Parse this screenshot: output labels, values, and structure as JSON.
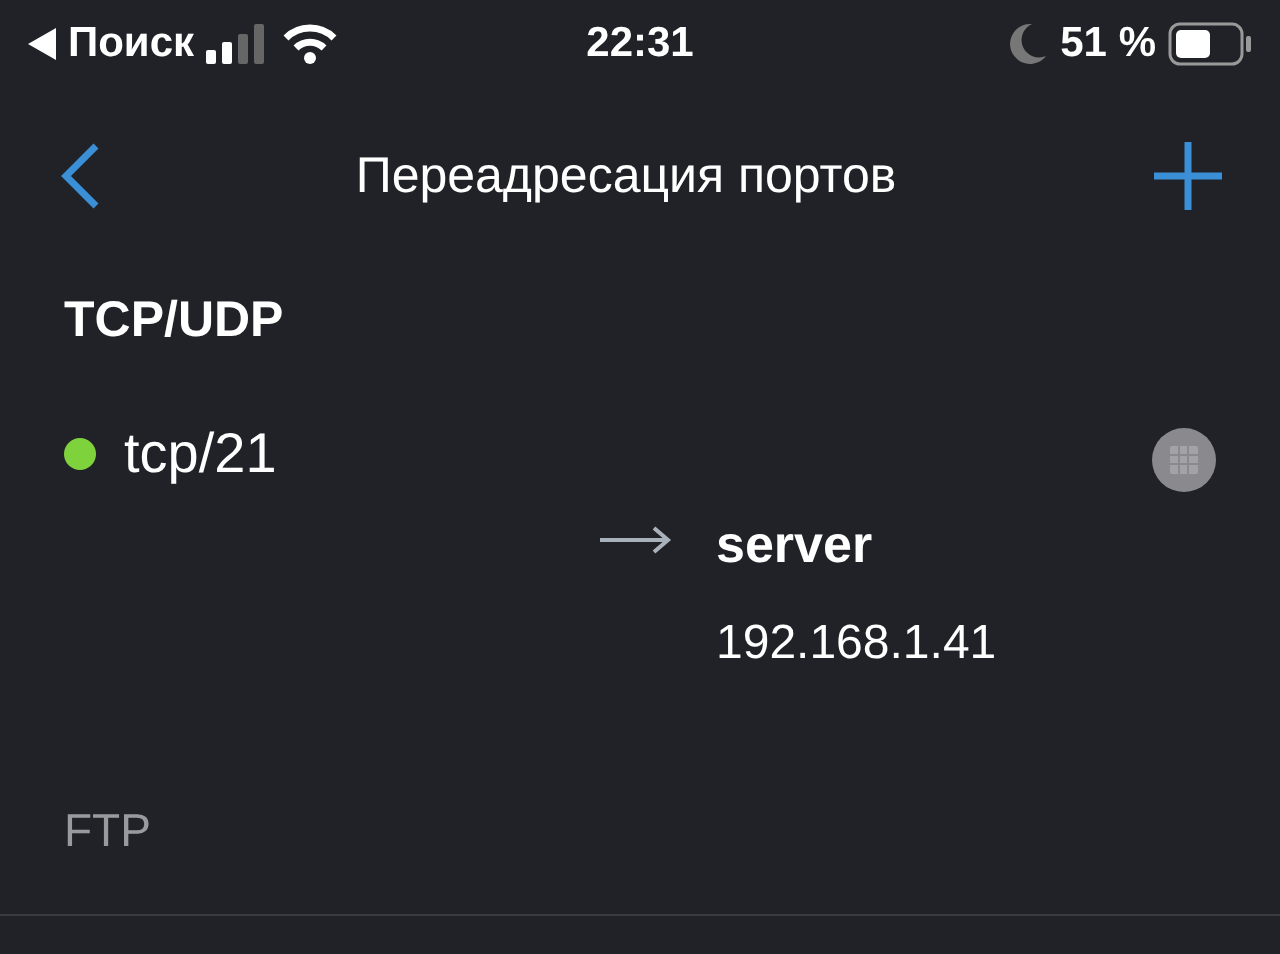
{
  "status_bar": {
    "back_label": "Поиск",
    "time": "22:31",
    "battery": "51 %"
  },
  "nav_bar": {
    "title": "Переадресация портов"
  },
  "section": {
    "title": "TCP/UDP"
  },
  "rules": [
    {
      "port": "tcp/21",
      "color": "#7ed23c",
      "target_name": "server",
      "target_ip": "192.168.1.41",
      "description": "FTP"
    }
  ]
}
